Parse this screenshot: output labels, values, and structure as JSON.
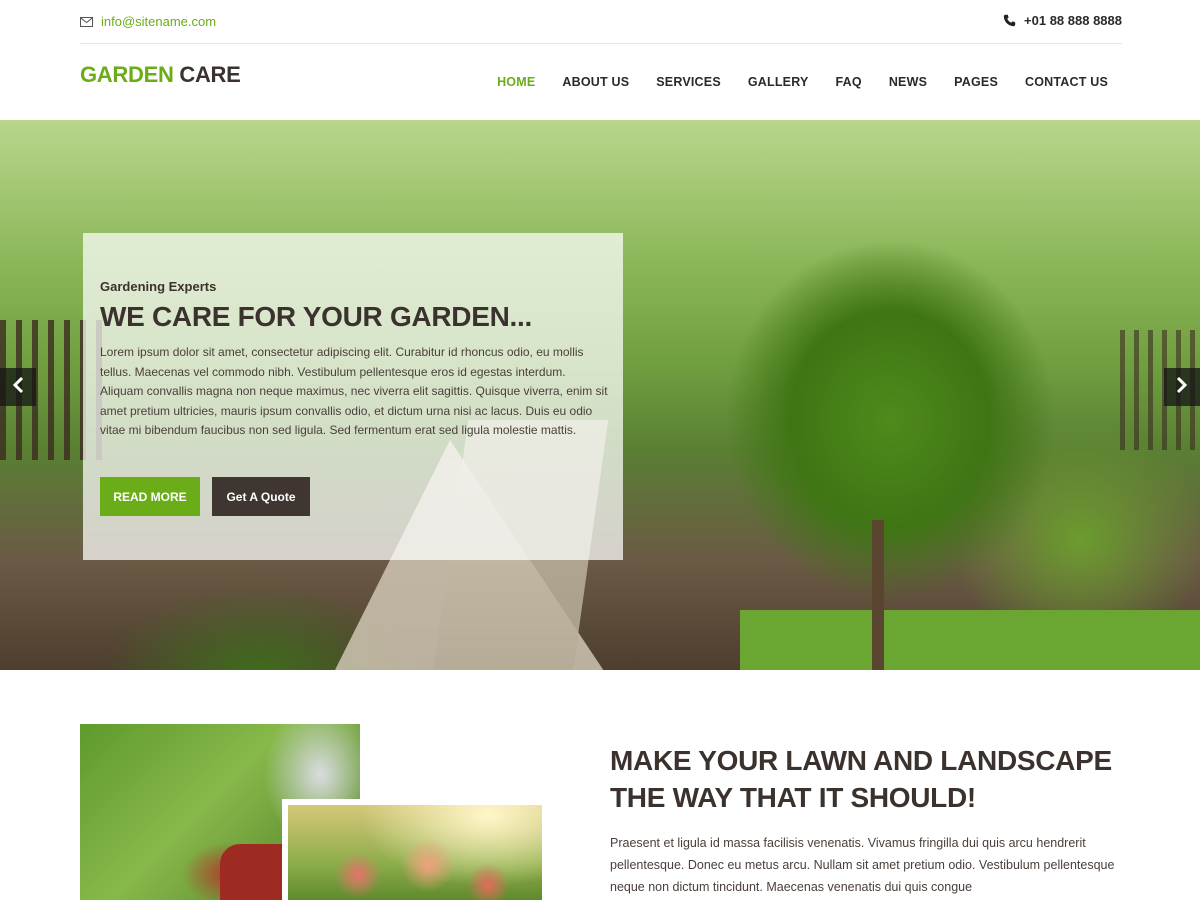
{
  "topbar": {
    "email": "info@sitename.com",
    "email_icon": "envelope-icon",
    "phone": "+01 88 888 8888",
    "phone_icon": "phone-icon"
  },
  "header": {
    "logo_part1": "GARDEN",
    "logo_part2": "CARE",
    "nav": [
      {
        "label": "HOME",
        "active": true
      },
      {
        "label": "ABOUT US"
      },
      {
        "label": "SERVICES"
      },
      {
        "label": "GALLERY"
      },
      {
        "label": "FAQ"
      },
      {
        "label": "NEWS"
      },
      {
        "label": "PAGES"
      },
      {
        "label": "CONTACT US"
      }
    ]
  },
  "hero": {
    "subtitle": "Gardening Experts",
    "title": "WE CARE FOR YOUR GARDEN...",
    "text": "Lorem ipsum dolor sit amet, consectetur adipiscing elit. Curabitur id rhoncus odio, eu mollis tellus. Maecenas vel commodo nibh. Vestibulum pellentesque eros id egestas interdum. Aliquam convallis magna non neque maximus, nec viverra elit sagittis. Quisque viverra, enim sit amet pretium ultricies, mauris ipsum convallis odio, et dictum urna nisi ac lacus. Duis eu odio vitae mi bibendum faucibus non sed ligula. Sed fermentum erat sed ligula molestie mattis.",
    "read_more": "READ MORE",
    "get_quote": "Get A Quote",
    "prev_icon": "chevron-left-icon",
    "next_icon": "chevron-right-icon"
  },
  "intro": {
    "title_line1": "MAKE YOUR LAWN AND LANDSCAPE",
    "title_line2": "THE WAY THAT IT SHOULD!",
    "text": "Praesent et ligula id massa facilisis venenatis. Vivamus fringilla dui quis arcu hendrerit pellentesque. Donec eu metus arcu. Nullam sit amet pretium odio. Vestibulum pellentesque neque non dictum tincidunt. Maecenas venenatis dui quis congue"
  },
  "colors": {
    "accent": "#6aad18",
    "dark": "#3b322e",
    "quote_button": "#3f3632"
  }
}
